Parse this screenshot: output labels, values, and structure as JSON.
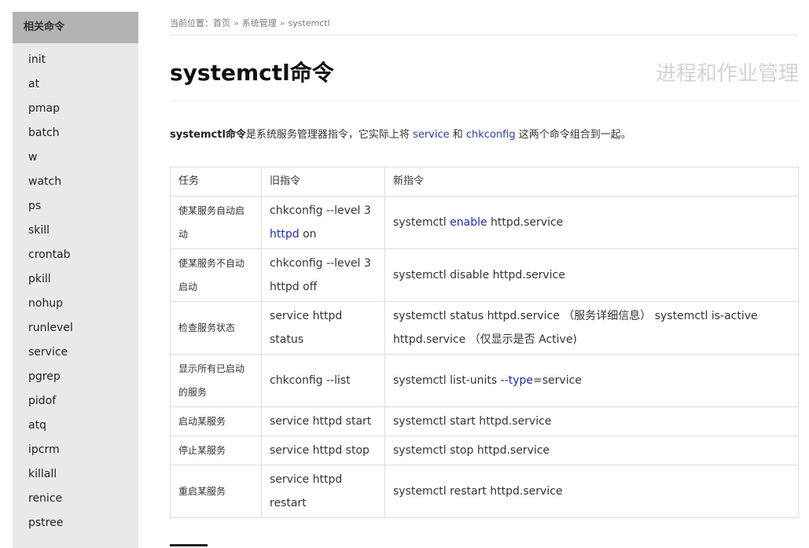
{
  "sidebar": {
    "header": "相关命令",
    "items": [
      "init",
      "at",
      "pmap",
      "batch",
      "w",
      "watch",
      "ps",
      "skill",
      "crontab",
      "pkill",
      "nohup",
      "runlevel",
      "service",
      "pgrep",
      "pidof",
      "atq",
      "ipcrm",
      "killall",
      "renice",
      "pstree"
    ]
  },
  "breadcrumb": {
    "prefix": "当前位置：",
    "home": "首页",
    "sep": "»",
    "section": "系统管理",
    "current": "systemctl"
  },
  "title": "systemctl命令",
  "category": "进程和作业管理",
  "intro": {
    "cmd": "systemctl命令",
    "text1": "是系统服务管理器指令，它实际上将 ",
    "link1": "service",
    "text2": " 和 ",
    "link2": "chkconfig",
    "text3": " 这两个命令组合到一起。"
  },
  "table": {
    "headers": [
      "任务",
      "旧指令",
      "新指令"
    ],
    "rows": [
      {
        "task": "使某服务自动启动",
        "old_a": "chkconfig --level 3 ",
        "old_kw": "httpd",
        "old_b": " on",
        "new_a": "systemctl ",
        "new_kw": "enable",
        "new_b": " httpd.service"
      },
      {
        "task": "使某服务不自动启动",
        "old": "chkconfig --level 3 httpd off",
        "new": "systemctl disable httpd.service"
      },
      {
        "task": "检查服务状态",
        "old": "service httpd status",
        "new": "systemctl status httpd.service （服务详细信息） systemctl is-active httpd.service （仅显示是否 Active)"
      },
      {
        "task": "显示所有已启动的服务",
        "old": "chkconfig --list",
        "new_a": "systemctl list-units --",
        "new_kw": "type",
        "new_b": "=service"
      },
      {
        "task": "启动某服务",
        "old": "service httpd start",
        "new": "systemctl start httpd.service"
      },
      {
        "task": "停止某服务",
        "old": "service httpd stop",
        "new": "systemctl stop httpd.service"
      },
      {
        "task": "重启某服务",
        "old": "service httpd restart",
        "new": "systemctl restart httpd.service"
      }
    ]
  },
  "colors": {
    "sidebar_bg": "#e9e9e9",
    "sidebar_header_bg": "#b3b3b3",
    "link": "#2a3d9c",
    "category": "#d3d3d3"
  }
}
